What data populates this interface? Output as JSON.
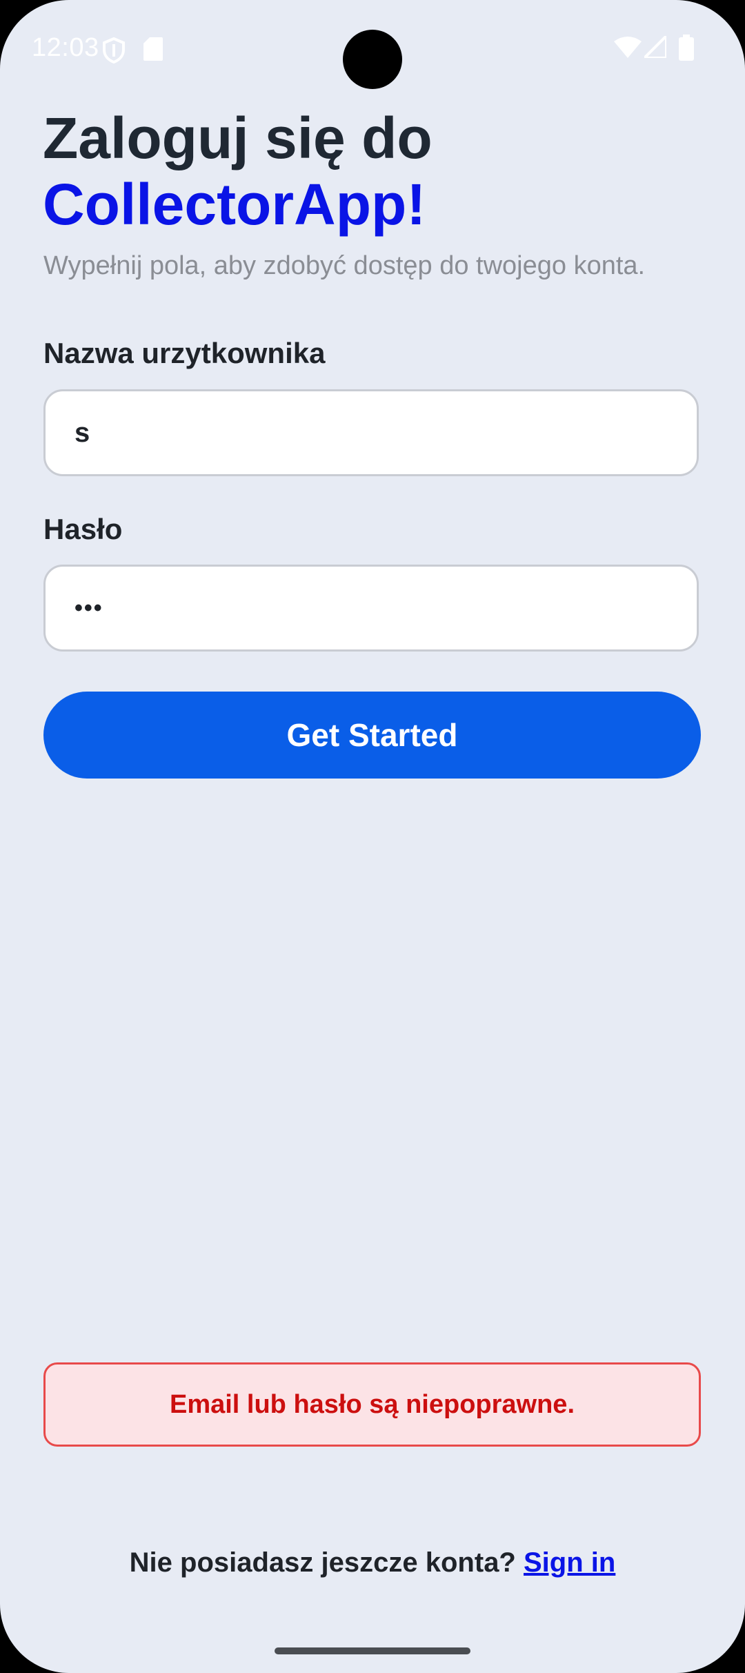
{
  "status_bar": {
    "time": "12:03",
    "icons_left": [
      "shield-icon",
      "sd-card-icon"
    ],
    "icons_right": [
      "wifi-icon",
      "signal-icon",
      "battery-icon"
    ]
  },
  "header": {
    "title_line1": "Zaloguj się do",
    "title_line2": "CollectorApp!",
    "subtitle": "Wypełnij pola, aby zdobyć dostęp do twojego konta."
  },
  "form": {
    "username_label": "Nazwa urzytkownika",
    "username_value": "s",
    "password_label": "Hasło",
    "password_value": "•••",
    "submit_label": "Get Started"
  },
  "error": {
    "message": "Email lub hasło są niepoprawne."
  },
  "footer": {
    "prompt": "Nie posiadasz jeszcze konta?",
    "link_label": "Sign in"
  },
  "colors": {
    "background": "#e7ebf4",
    "accent": "#0a14e6",
    "button": "#0a5ee8",
    "error_text": "#cc0f0f",
    "error_bg": "#fce3e6"
  }
}
